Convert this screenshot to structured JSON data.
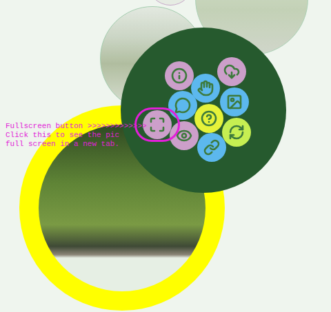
{
  "annotation": {
    "lines": [
      "Fullscreen button >>>>>>>>>>>>>",
      "Click this to see the pic",
      "full screen in a new tab."
    ]
  },
  "menu_buttons": [
    {
      "name": "info",
      "color": "#cc9fca",
      "highlighted": false
    },
    {
      "name": "hand",
      "color": "#5cb8ee",
      "highlighted": false
    },
    {
      "name": "download",
      "color": "#cc9fca",
      "highlighted": false
    },
    {
      "name": "comment",
      "color": "#5cb8ee",
      "highlighted": false
    },
    {
      "name": "picture",
      "color": "#5cb8ee",
      "highlighted": false
    },
    {
      "name": "help",
      "color": "#e6f23a",
      "highlighted": false
    },
    {
      "name": "refresh",
      "color": "#c6ef52",
      "highlighted": false
    },
    {
      "name": "fullscreen",
      "color": "#cc9fca",
      "highlighted": true
    },
    {
      "name": "eye",
      "color": "#cc9fca",
      "highlighted": false
    },
    {
      "name": "link",
      "color": "#5cb8ee",
      "highlighted": false
    }
  ]
}
